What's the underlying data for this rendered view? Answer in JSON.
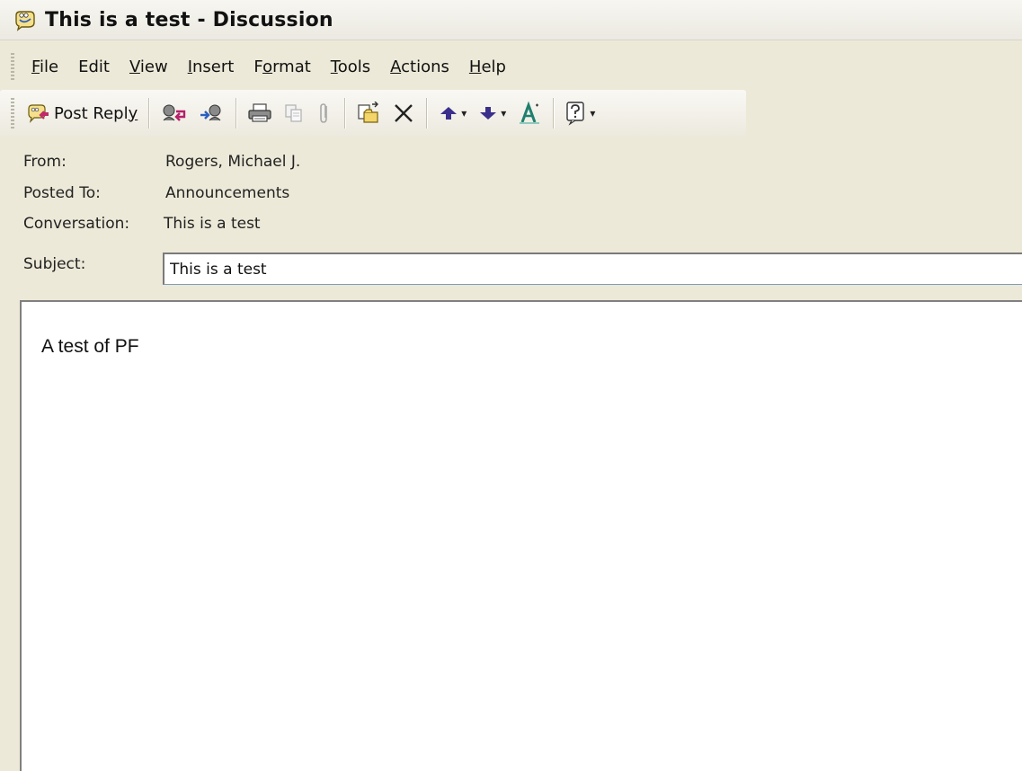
{
  "window": {
    "title": "This is a test - Discussion",
    "icon": "discussion-post-icon"
  },
  "menu": {
    "items": [
      {
        "label": "File",
        "accel": "F",
        "rest": "ile"
      },
      {
        "label": "Edit",
        "accel": "",
        "rest": "Edit"
      },
      {
        "label": "View",
        "accel": "V",
        "rest": "iew"
      },
      {
        "label": "Insert",
        "accel": "I",
        "rest": "nsert"
      },
      {
        "label": "Format",
        "accel_pre": "F",
        "accel": "o",
        "rest": "rmat"
      },
      {
        "label": "Tools",
        "accel": "T",
        "rest": "ools"
      },
      {
        "label": "Actions",
        "accel": "A",
        "rest": "ctions"
      },
      {
        "label": "Help",
        "accel": "H",
        "rest": "elp"
      }
    ]
  },
  "toolbar": {
    "post_reply_label": "Post Repl",
    "post_reply_accel": "y",
    "icons": [
      "post-reply-icon",
      "reply-to-user-icon",
      "forward-user-icon",
      "print-icon",
      "copy-icon",
      "attach-icon",
      "move-to-folder-icon",
      "delete-icon",
      "previous-item-icon",
      "next-item-icon",
      "format-text-icon",
      "help-icon"
    ]
  },
  "header": {
    "from_label": "From:",
    "from_value": "Rogers, Michael J.",
    "posted_to_label": "Posted To:",
    "posted_to_value": "Announcements",
    "conversation_label": "Conversation:",
    "conversation_value": "This is a test",
    "subject_label_pre": "Sub",
    "subject_label_accel": "j",
    "subject_label_post": "ect:",
    "subject_value": "This is a test"
  },
  "body": {
    "text": "A test of PF"
  },
  "colors": {
    "window_bg": "#ece9d8",
    "arrow_purple": "#3b2f8c",
    "input_border": "#7f9db9"
  }
}
